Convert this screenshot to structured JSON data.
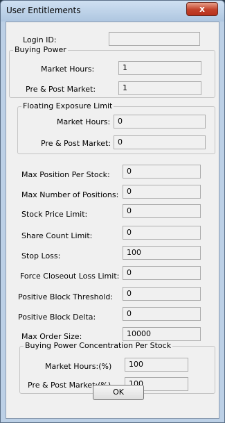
{
  "window": {
    "title": "User Entitlements",
    "close_glyph": "x"
  },
  "login": {
    "label": "Login ID:",
    "value": ""
  },
  "buying_power": {
    "caption": "Buying Power",
    "market_hours": {
      "label": "Market Hours:",
      "value": "1"
    },
    "pre_post": {
      "label": "Pre & Post Market:",
      "value": "1"
    }
  },
  "floating_exposure": {
    "caption": "Floating Exposure Limit",
    "market_hours": {
      "label": "Market Hours:",
      "value": "0"
    },
    "pre_post": {
      "label": "Pre & Post Market:",
      "value": "0"
    }
  },
  "fields": {
    "max_position": {
      "label": "Max Position Per Stock:",
      "value": "0"
    },
    "max_positions": {
      "label": "Max Number of Positions:",
      "value": "0"
    },
    "stock_price_limit": {
      "label": "Stock Price Limit:",
      "value": "0"
    },
    "share_count_limit": {
      "label": "Share Count Limit:",
      "value": "0"
    },
    "stop_loss": {
      "label": "Stop Loss:",
      "value": "100"
    },
    "force_closeout": {
      "label": "Force Closeout Loss Limit:",
      "value": "0"
    },
    "pos_block_threshold": {
      "label": "Positive Block Threshold:",
      "value": "0"
    },
    "pos_block_delta": {
      "label": "Positive Block Delta:",
      "value": "0"
    },
    "max_order_size": {
      "label": "Max Order Size:",
      "value": "10000"
    }
  },
  "concentration": {
    "caption": "Buying Power Concentration Per Stock",
    "market_hours": {
      "label": "Market Hours:(%)",
      "value": "100"
    },
    "pre_post": {
      "label": "Pre & Post Market:(%)",
      "value": "100"
    }
  },
  "ok_label": "OK"
}
